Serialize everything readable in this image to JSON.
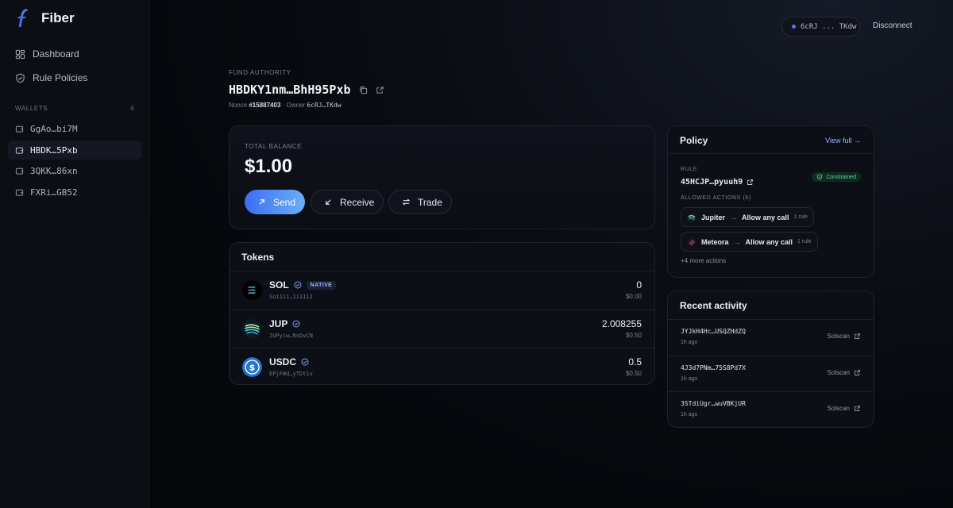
{
  "app": {
    "name": "Fiber"
  },
  "sidebar": {
    "nav": [
      {
        "label": "Dashboard",
        "icon": "grid-icon"
      },
      {
        "label": "Rule Policies",
        "icon": "shield-icon"
      }
    ],
    "wallets_header": "WALLETS",
    "wallets_count": "4",
    "wallets": [
      {
        "label": "GgAo…bi7M",
        "active": false
      },
      {
        "label": "HBDK…5Pxb",
        "active": true
      },
      {
        "label": "3QKK…86xn",
        "active": false
      },
      {
        "label": "FXRi…GB52",
        "active": false
      }
    ]
  },
  "header": {
    "wallet_short": "6cRJ ... TKdw",
    "disconnect_label": "Disconnect"
  },
  "fund": {
    "label": "FUND AUTHORITY",
    "address": "HBDKY1nm…BhH95Pxb",
    "nonce_label": "Nonce",
    "nonce": "#15887403",
    "owner_label": "· Owner",
    "owner": "6cRJ…TKdw"
  },
  "balance": {
    "label": "TOTAL BALANCE",
    "value": "$1.00",
    "send_label": "Send",
    "receive_label": "Receive",
    "trade_label": "Trade"
  },
  "tokens": {
    "title": "Tokens",
    "items": [
      {
        "symbol": "SOL",
        "badge": "NATIVE",
        "mint": "So1111…111112",
        "amount": "0",
        "usd": "$0.00"
      },
      {
        "symbol": "JUP",
        "badge": "",
        "mint": "JUPyiw…NsDvCN",
        "amount": "2.008255",
        "usd": "$0.50"
      },
      {
        "symbol": "USDC",
        "badge": "",
        "mint": "EPjFWd…yTDt1v",
        "amount": "0.5",
        "usd": "$0.50"
      }
    ]
  },
  "policy": {
    "title": "Policy",
    "view_full": "View full →",
    "rule_label": "RULE",
    "rule_address": "45HCJP…pyuuh9",
    "status": "Constrained",
    "allowed_label": "ALLOWED ACTIONS (6)",
    "actions": [
      {
        "program": "Jupiter",
        "permission": "Allow any call",
        "count": "1 rule"
      },
      {
        "program": "Meteora",
        "permission": "Allow any call",
        "count": "1 rule"
      }
    ],
    "more": "+4 more actions"
  },
  "activity": {
    "title": "Recent activity",
    "items": [
      {
        "hash": "JYJkH4Hc…USQZHdZQ",
        "time": "1h ago",
        "link": "Solscan"
      },
      {
        "hash": "4J3d7PNm…75S8Pd7X",
        "time": "1h ago",
        "link": "Solscan"
      },
      {
        "hash": "3STdiUgr…wuVBKjUR",
        "time": "1h ago",
        "link": "Solscan"
      }
    ]
  },
  "colors": {
    "accent": "#4f7df5",
    "send_gradient_start": "#3c6df5",
    "send_gradient_end": "#6aaff5",
    "success": "#5fd39a",
    "background": "#06070b"
  }
}
